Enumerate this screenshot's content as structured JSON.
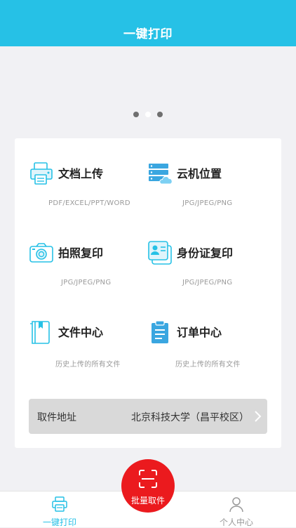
{
  "header": {
    "title": "一键打印"
  },
  "banner": {
    "dots": [
      {
        "active": false
      },
      {
        "active": true
      },
      {
        "active": false
      }
    ]
  },
  "grid": {
    "items": [
      {
        "label": "文档上传",
        "sub": "PDF/EXCEL/PPT/WORD",
        "icon": "printer-icon"
      },
      {
        "label": "云机位置",
        "sub": "JPG/JPEG/PNG",
        "icon": "cloud-server-icon"
      },
      {
        "label": "拍照复印",
        "sub": "JPG/JPEG/PNG",
        "icon": "camera-icon"
      },
      {
        "label": "身份证复印",
        "sub": "JPG/JPEG/PNG",
        "icon": "id-card-icon"
      },
      {
        "label": "文件中心",
        "sub": "历史上传的所有文件",
        "icon": "book-icon"
      },
      {
        "label": "订单中心",
        "sub": "历史上传的所有文件",
        "icon": "clipboard-icon"
      }
    ]
  },
  "pickup": {
    "label": "取件地址",
    "value": "北京科技大学（昌平校区）"
  },
  "tabbar": {
    "left": {
      "label": "一键打印",
      "icon": "printer-icon",
      "active": true
    },
    "center": {
      "label": "批量取件",
      "icon": "scan-icon"
    },
    "right": {
      "label": "个人中心",
      "icon": "user-icon"
    }
  },
  "colors": {
    "primary": "#26c1e6",
    "accent_red": "#eb1a1e",
    "tab_inactive": "#999999"
  }
}
